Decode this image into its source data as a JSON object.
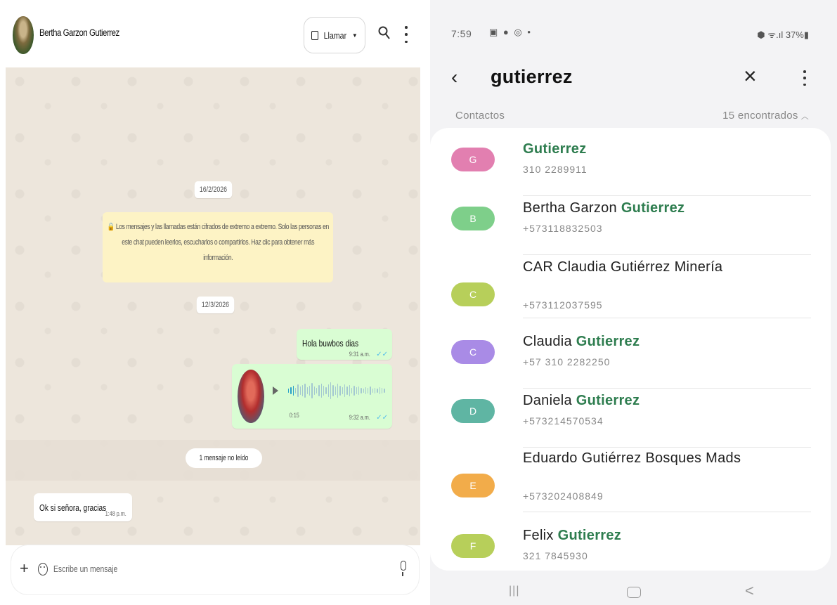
{
  "chat": {
    "contact_name": "Bertha Garzon Gutierrez",
    "call_label": "Llamar",
    "date_1": "16/2/2026",
    "encryption_notice": "🔒 Los mensajes y las llamadas están cifrados de extremo a extremo. Solo las personas en este chat pueden leerlos, escucharlos o compartirlos. Haz clic para obtener más información.",
    "date_2": "12/3/2026",
    "out_message_1": {
      "text": "Hola buwbos dias",
      "time": "9:31 a.m.",
      "ticks": "✓✓"
    },
    "voice_message": {
      "duration": "0:15",
      "time": "9:32 a.m.",
      "ticks": "✓✓",
      "progress": 0.08
    },
    "unread_label": "1 mensaje no leído",
    "in_message_1": {
      "text": "Ok si señora, gracias",
      "time": "1:48 p.m."
    },
    "composer_placeholder": "Escribe un mensaje",
    "icons": [
      "search-icon",
      "more-icon",
      "video-call-icon",
      "plus-icon",
      "sticker-icon",
      "mic-icon",
      "play-icon"
    ]
  },
  "phone": {
    "status": {
      "time": "7:59",
      "icons": "▣ ● ◎ •",
      "right": "⬢ ᯤ.ıl 37%▮"
    },
    "search_query": "gutierrez",
    "section_label": "Contactos",
    "results_count": "15 encontrados",
    "contacts": [
      {
        "initial": "G",
        "color": "#e27fb0",
        "name_pre": "",
        "name_match": "Gutierrez",
        "name_post": "",
        "phone": "310 2289911"
      },
      {
        "initial": "B",
        "color": "#7ecf8a",
        "name_pre": "Bertha Garzon ",
        "name_match": "Gutierrez",
        "name_post": "",
        "phone": "+573118832503"
      },
      {
        "initial": "C",
        "color": "#b7cf5a",
        "name_pre": "CAR Claudia Gutiérrez Minería",
        "name_match": "",
        "name_post": "",
        "phone": "+573112037595"
      },
      {
        "initial": "C",
        "color": "#a98be6",
        "name_pre": "Claudia ",
        "name_match": "Gutierrez",
        "name_post": "",
        "phone": "+57 310 2282250"
      },
      {
        "initial": "D",
        "color": "#5fb5a3",
        "name_pre": "Daniela ",
        "name_match": "Gutierrez",
        "name_post": "",
        "phone": "+573214570534"
      },
      {
        "initial": "E",
        "color": "#f2ac4a",
        "name_pre": "Eduardo Gutiérrez Bosques Mads",
        "name_match": "",
        "name_post": "",
        "phone": "+573202408849"
      },
      {
        "initial": "F",
        "color": "#b7cf5a",
        "name_pre": "Felix ",
        "name_match": "Gutierrez",
        "name_post": "",
        "phone": "321 7845930"
      }
    ]
  }
}
